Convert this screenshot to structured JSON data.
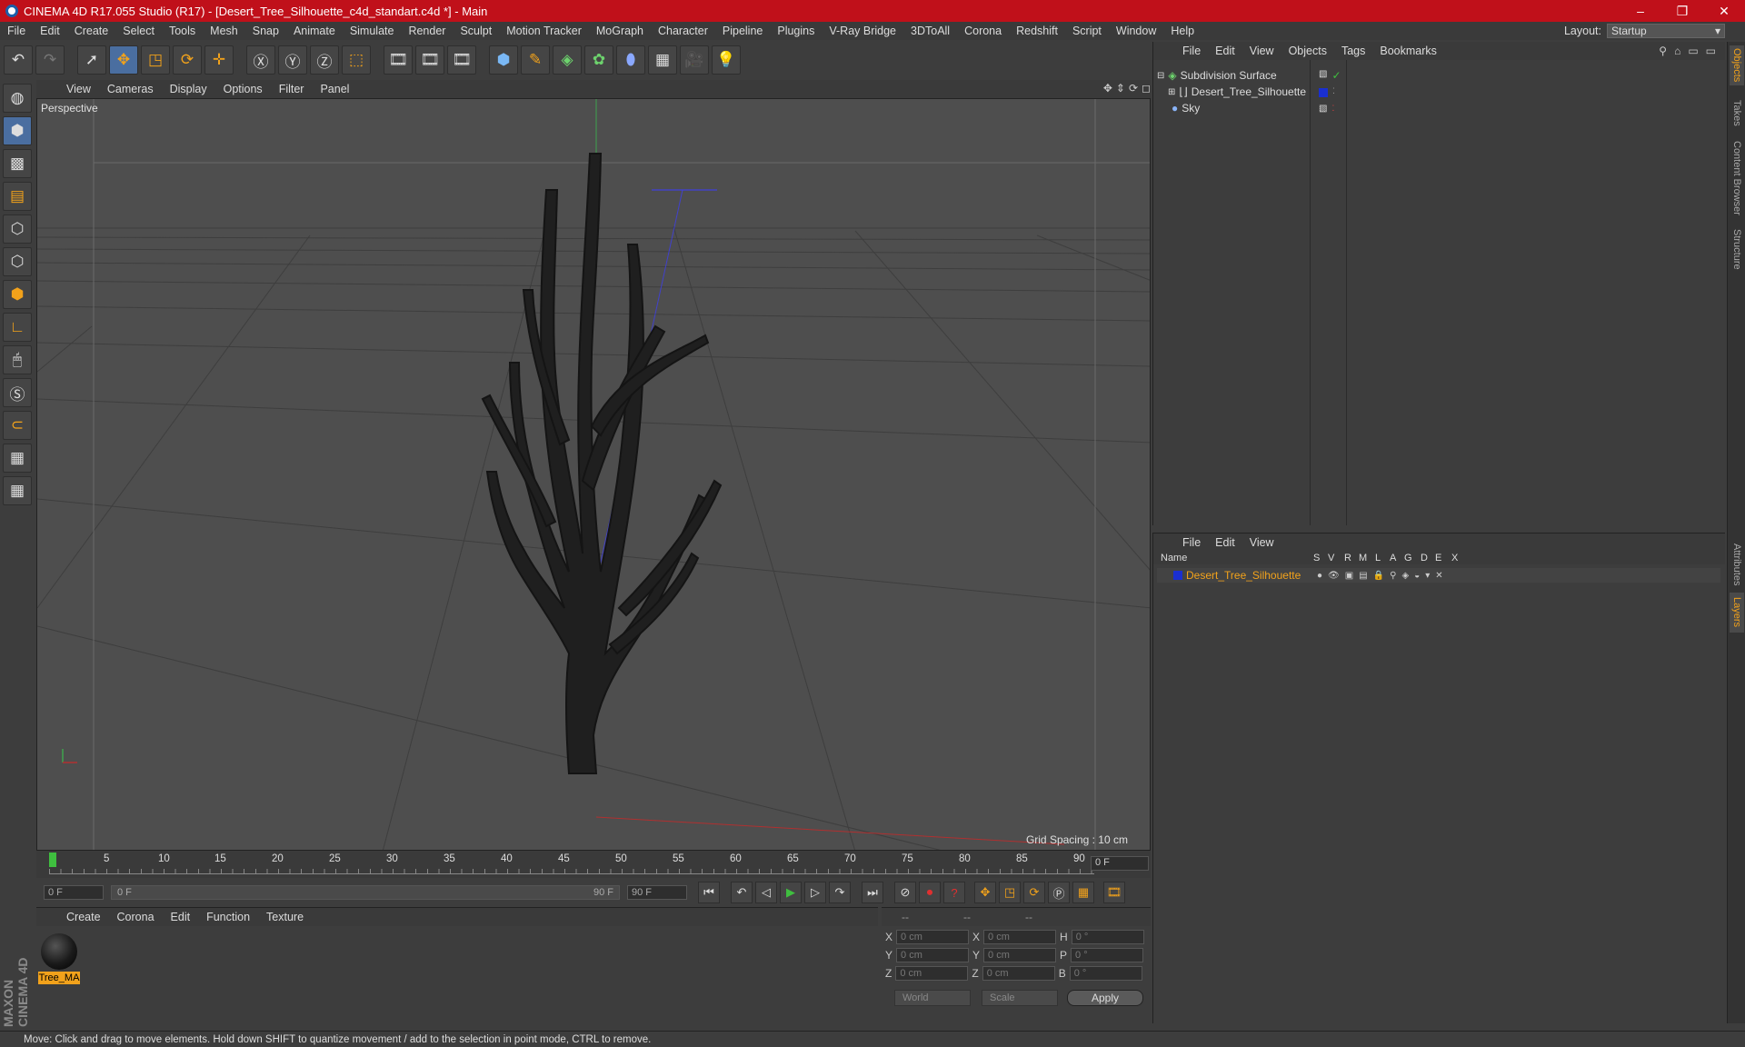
{
  "window": {
    "title": "CINEMA 4D R17.055 Studio (R17) - [Desert_Tree_Silhouette_c4d_standart.c4d *] - Main",
    "controls": [
      "–",
      "❐",
      "✕"
    ]
  },
  "menubar": [
    "File",
    "Edit",
    "Create",
    "Select",
    "Tools",
    "Mesh",
    "Snap",
    "Animate",
    "Simulate",
    "Render",
    "Sculpt",
    "Motion Tracker",
    "MoGraph",
    "Character",
    "Pipeline",
    "Plugins",
    "V-Ray Bridge",
    "3DToAll",
    "Corona",
    "Redshift",
    "Script",
    "Window",
    "Help"
  ],
  "layout": {
    "label": "Layout:",
    "value": "Startup"
  },
  "viewport": {
    "menu": [
      "View",
      "Cameras",
      "Display",
      "Options",
      "Filter",
      "Panel"
    ],
    "camera_label": "Perspective",
    "grid_spacing": "Grid Spacing : 10 cm"
  },
  "timeline": {
    "ticks": [
      "0",
      "5",
      "10",
      "15",
      "20",
      "25",
      "30",
      "35",
      "40",
      "45",
      "50",
      "55",
      "60",
      "65",
      "70",
      "75",
      "80",
      "85",
      "90"
    ],
    "current_frame": "0 F",
    "start_field": "0 F",
    "range_start": "0 F",
    "range_end": "90 F",
    "end_field": "90 F"
  },
  "material_panel": {
    "menu": [
      "Create",
      "Corona",
      "Edit",
      "Function",
      "Texture"
    ],
    "material_name": "Tree_MA"
  },
  "coords": {
    "headers": [
      "--",
      "--",
      "--"
    ],
    "rows": [
      {
        "a": "X",
        "av": "0 cm",
        "b": "X",
        "bv": "0 cm",
        "c": "H",
        "cv": "0 °"
      },
      {
        "a": "Y",
        "av": "0 cm",
        "b": "Y",
        "bv": "0 cm",
        "c": "P",
        "cv": "0 °"
      },
      {
        "a": "Z",
        "av": "0 cm",
        "b": "Z",
        "bv": "0 cm",
        "c": "B",
        "cv": "0 °"
      }
    ],
    "mode1": "World",
    "mode2": "Scale",
    "apply": "Apply"
  },
  "objects_panel": {
    "menu": [
      "File",
      "Edit",
      "View",
      "Objects",
      "Tags",
      "Bookmarks"
    ],
    "items": [
      {
        "name": "Subdivision Surface"
      },
      {
        "name": "Desert_Tree_Silhouette"
      },
      {
        "name": "Sky"
      }
    ]
  },
  "layers_panel": {
    "menu": [
      "File",
      "Edit",
      "View"
    ],
    "columns": [
      "Name",
      "S",
      "V",
      "R",
      "M",
      "L",
      "A",
      "G",
      "D",
      "E",
      "X"
    ],
    "layer_name": "Desert_Tree_Silhouette"
  },
  "side_tabs_top": [
    "Objects",
    "Takes",
    "Content Browser",
    "Structure"
  ],
  "side_tabs_bottom": [
    "Attributes",
    "Layers"
  ],
  "brand": "MAXON CINEMA 4D",
  "status": "Move: Click and drag to move elements. Hold down SHIFT to quantize movement / add to the selection in point mode, CTRL to remove.",
  "colors": {
    "title_bar": "#c0101a",
    "accent": "#f2a21b",
    "layer_blue": "#1a2fd0"
  }
}
